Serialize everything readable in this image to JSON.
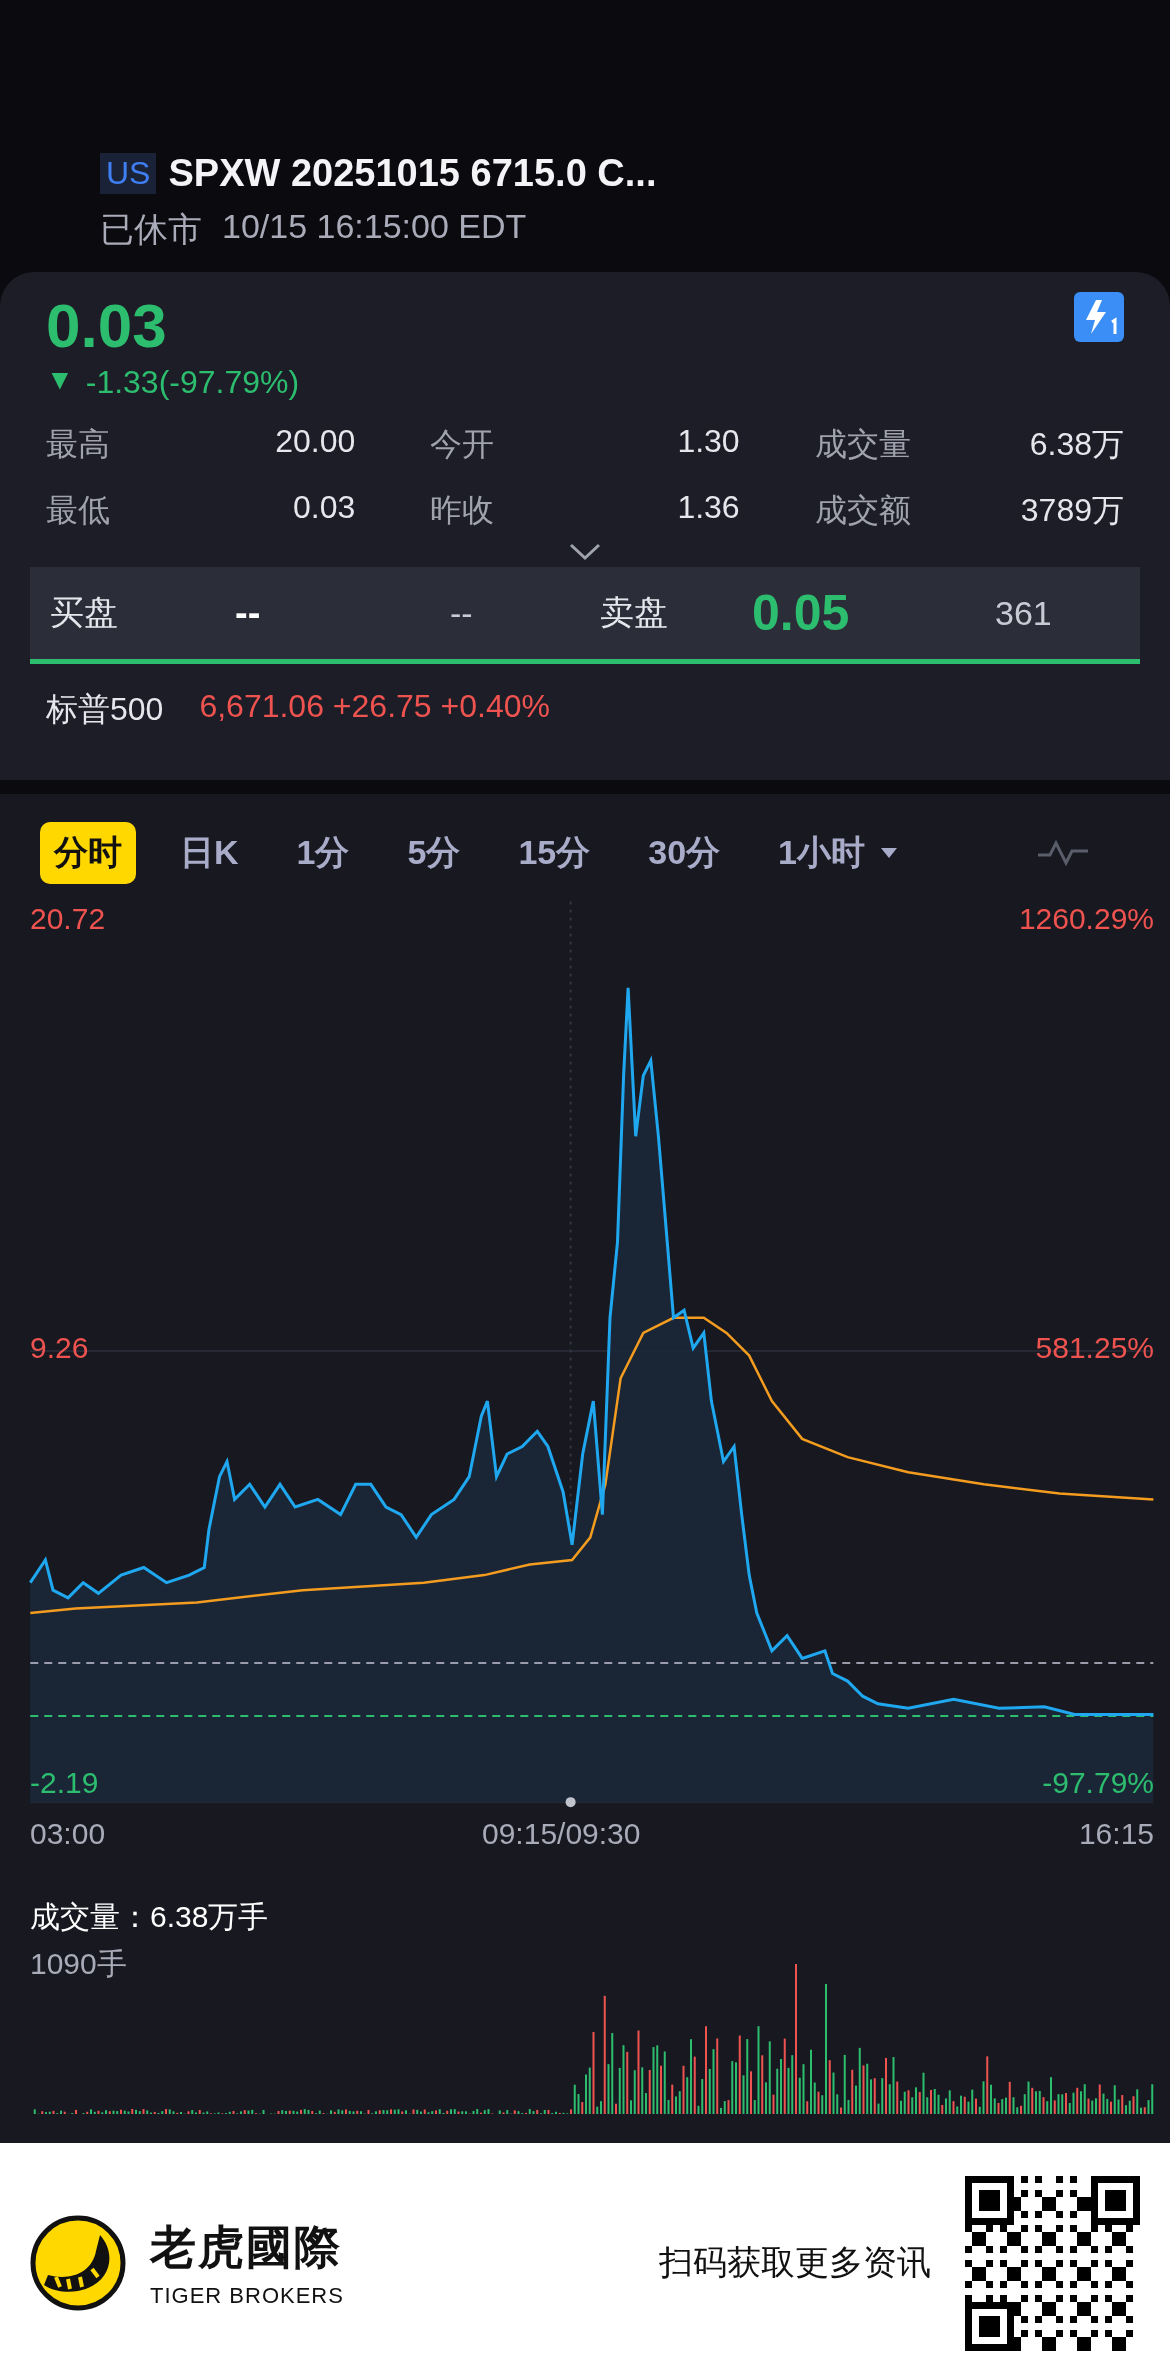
{
  "header": {
    "market_badge": "US",
    "title": "SPXW 20251015 6715.0 C...",
    "status": "已休市",
    "timestamp": "10/15 16:15:00 EDT"
  },
  "quote": {
    "price": "0.03",
    "change_marker": "▼",
    "change": "-1.33(-97.79%)",
    "stats": [
      {
        "label": "最高",
        "value": "20.00"
      },
      {
        "label": "今开",
        "value": "1.30"
      },
      {
        "label": "成交量",
        "value": "6.38万"
      },
      {
        "label": "最低",
        "value": "0.03"
      },
      {
        "label": "昨收",
        "value": "1.36"
      },
      {
        "label": "成交额",
        "value": "3789万"
      }
    ],
    "order_book": {
      "bid_label": "买盘",
      "bid_price": "--",
      "bid_size": "--",
      "ask_label": "卖盘",
      "ask_price": "0.05",
      "ask_size": "361"
    },
    "index": {
      "name": "标普500",
      "value": "6,671.06 +26.75 +0.40%"
    }
  },
  "chart_tabs": [
    {
      "label": "分时",
      "selected": true,
      "dropdown": false
    },
    {
      "label": "日K",
      "selected": false,
      "dropdown": false
    },
    {
      "label": "1分",
      "selected": false,
      "dropdown": false
    },
    {
      "label": "5分",
      "selected": false,
      "dropdown": false
    },
    {
      "label": "15分",
      "selected": false,
      "dropdown": false
    },
    {
      "label": "30分",
      "selected": false,
      "dropdown": false
    },
    {
      "label": "1小时",
      "selected": false,
      "dropdown": true
    }
  ],
  "price_chart": {
    "left_labels": [
      "20.72",
      "9.26",
      "-2.19"
    ],
    "right_labels": [
      "1260.29%",
      "581.25%",
      "-97.79%"
    ],
    "time_labels": [
      "03:00",
      "09:15/09:30",
      "16:15"
    ]
  },
  "volume": {
    "title": "成交量：",
    "total": "6.38万手",
    "max_label": "1090手"
  },
  "footer": {
    "brand": "老虎國際",
    "brand_en": "TIGER BROKERS",
    "cta": "扫码获取更多资讯"
  }
}
